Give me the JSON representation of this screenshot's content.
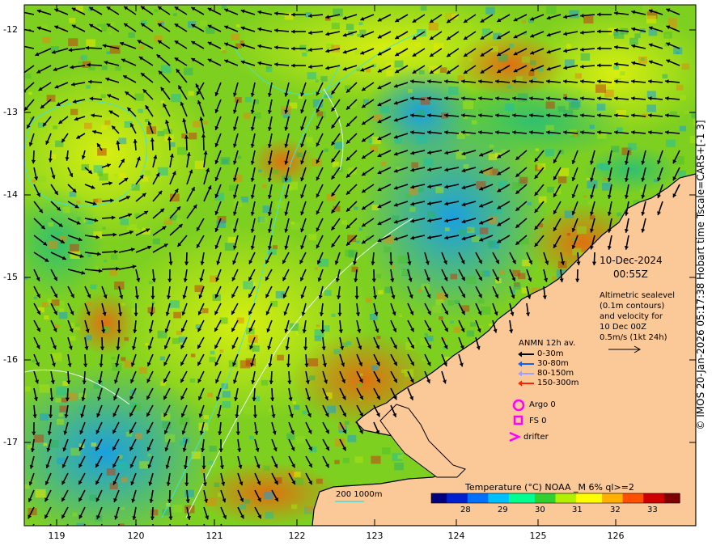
{
  "datetime": {
    "date": "10-Dec-2024",
    "time": "00:55Z"
  },
  "altimetry_note": [
    "Altimetric sealevel",
    "(0.1m contours)",
    "and velocity for",
    "10 Dec 00Z",
    "0.5m/s (1kt 24h)"
  ],
  "anmn_legend": {
    "title": "ANMN 12h av.",
    "items": [
      {
        "label": "0-30m",
        "color": "#000000"
      },
      {
        "label": "30-80m",
        "color": "#1060ff"
      },
      {
        "label": "80-150m",
        "color": "#a0a0ff"
      },
      {
        "label": "150-300m",
        "color": "#ff2000"
      }
    ]
  },
  "markers": [
    {
      "label": "Argo 0",
      "icon": "circle-icon",
      "color": "#ff00ff"
    },
    {
      "label": "FS 0",
      "icon": "square-icon",
      "color": "#ff00ff"
    },
    {
      "label": "drifter",
      "icon": "chevron-icon",
      "color": "#ff00ff"
    }
  ],
  "depth_legend": {
    "values": "200  1000m",
    "color": "#40e0e0"
  },
  "colorbar": {
    "title": "Temperature (°C) NOAA _M 6% ql>=2",
    "ticks": [
      "28",
      "29",
      "30",
      "31",
      "32",
      "33"
    ],
    "colors": [
      "#00007f",
      "#0020d0",
      "#0070ff",
      "#00c0ff",
      "#00ff90",
      "#30d030",
      "#b0f000",
      "#ffff00",
      "#ffb000",
      "#ff5000",
      "#d00000",
      "#7f0000"
    ]
  },
  "axes": {
    "lat_ticks": [
      "-12",
      "-13",
      "-14",
      "-15",
      "-16",
      "-17"
    ],
    "lon_ticks": [
      "119",
      "120",
      "121",
      "122",
      "123",
      "124",
      "125",
      "126"
    ]
  },
  "copyright": "© IMOS 20-Jan-2026 05:17:38 Hobart time Tscale=CARS+[-1 3]",
  "colors": {
    "land": "#fbc898",
    "contour": "#40e0e0",
    "arrow": "#000000"
  }
}
